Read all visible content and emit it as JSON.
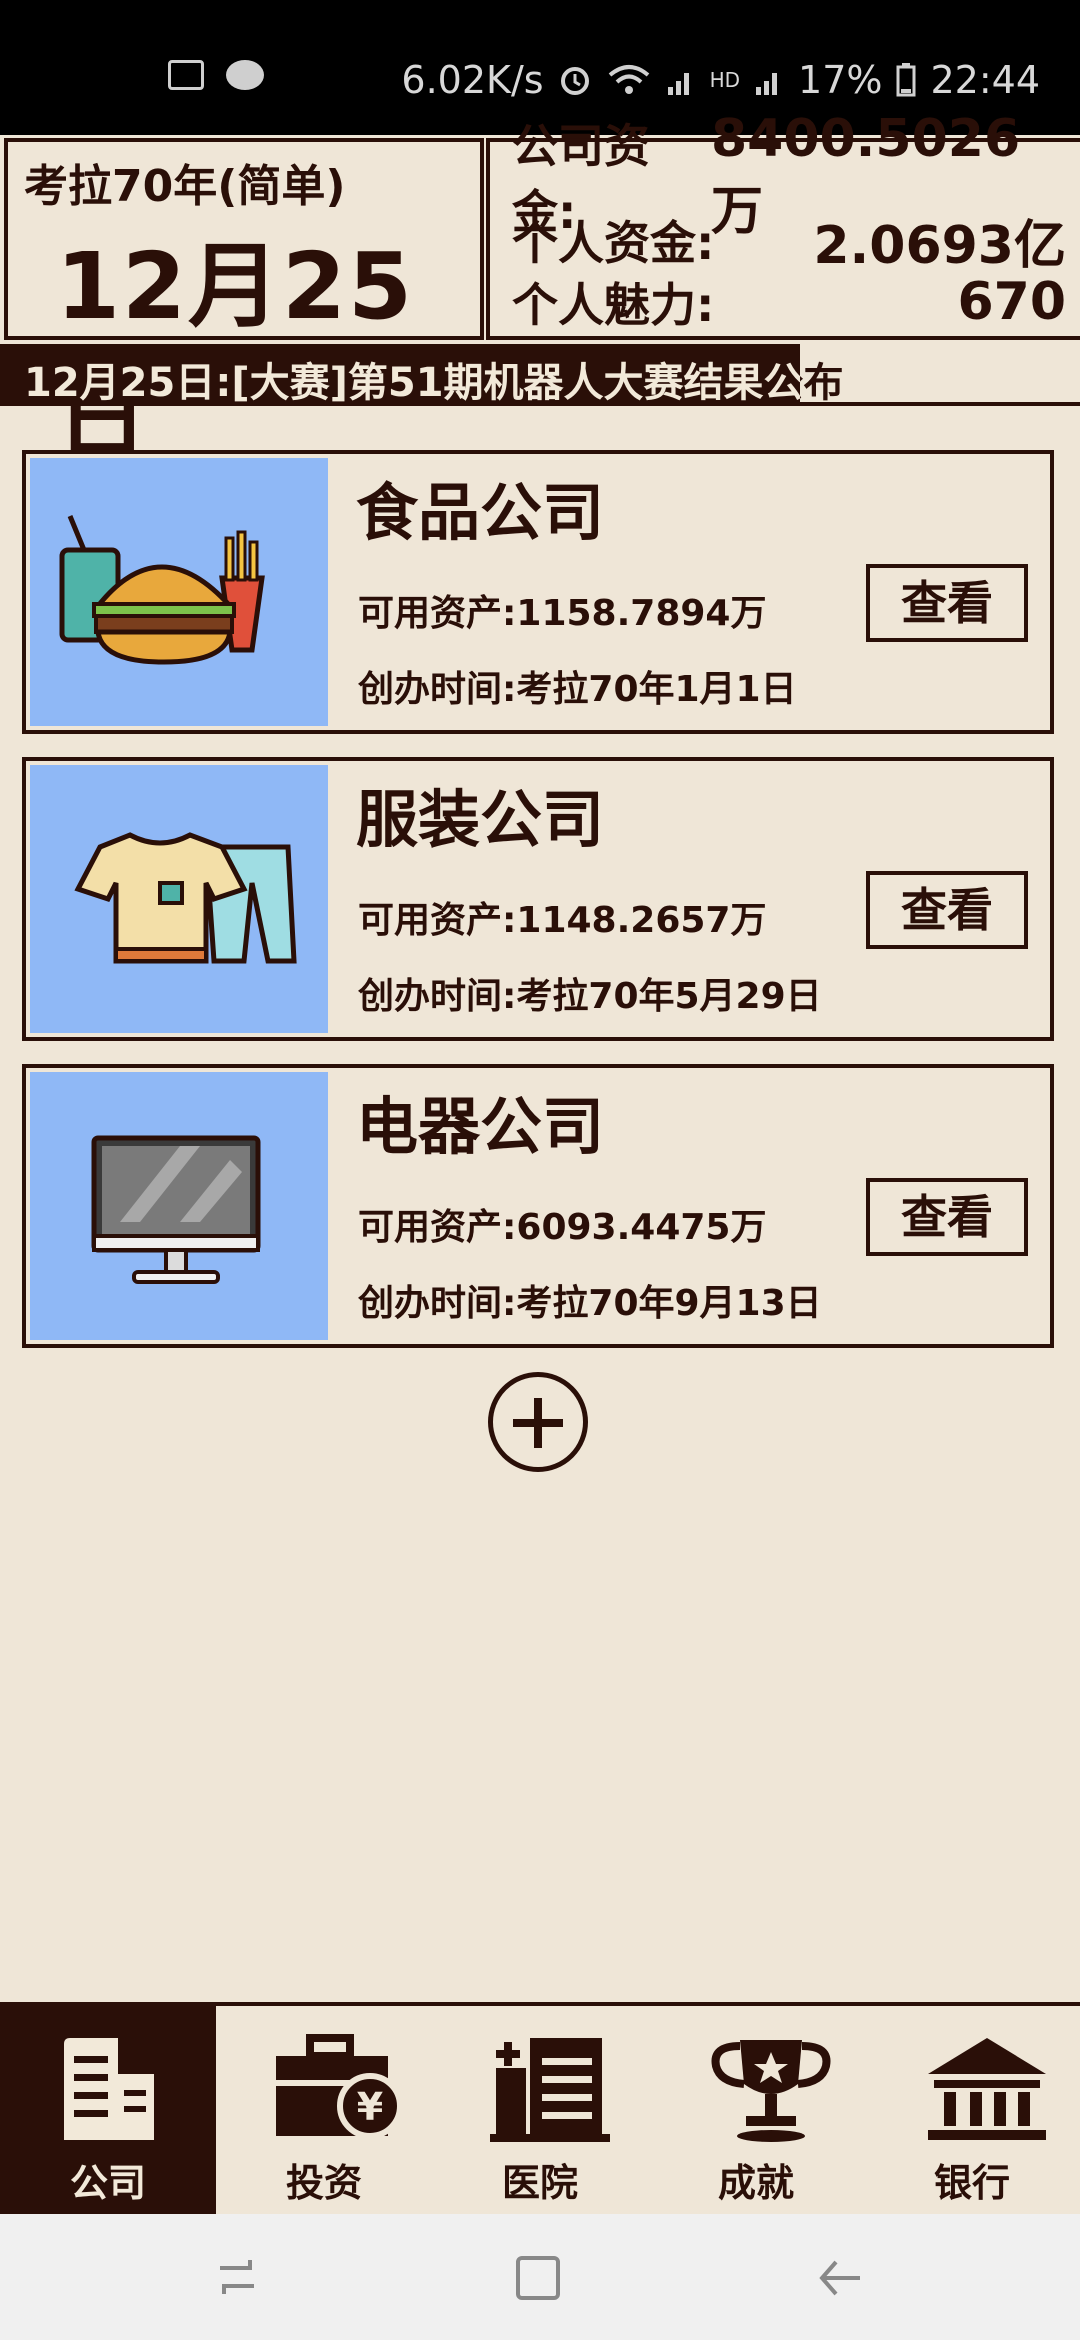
{
  "status_bar": {
    "network_speed": "6.02K/s",
    "hd": "HD",
    "battery": "17%",
    "time": "22:44"
  },
  "header": {
    "mode": "考拉70年(简单)",
    "date": "12月25日",
    "company_funds_label": "公司资金:",
    "company_funds_value": "8400.5026万",
    "personal_funds_label": "个人资金:",
    "personal_funds_value": "2.0693亿",
    "charm_label": "个人魅力:",
    "charm_value": "670"
  },
  "ticker": {
    "text": "12月25日:[大赛]第51期机器人大赛结果公布"
  },
  "companies": [
    {
      "name": "食品公司",
      "assets": "可用资产:1158.7894万",
      "founded": "创办时间:考拉70年1月1日",
      "button": "查看",
      "icon": "food-icon"
    },
    {
      "name": "服装公司",
      "assets": "可用资产:1148.2657万",
      "founded": "创办时间:考拉70年5月29日",
      "button": "查看",
      "icon": "clothing-icon"
    },
    {
      "name": "电器公司",
      "assets": "可用资产:6093.4475万",
      "founded": "创办时间:考拉70年9月13日",
      "button": "查看",
      "icon": "monitor-icon"
    }
  ],
  "nav": {
    "items": [
      {
        "label": "公司",
        "icon": "building-icon",
        "active": true
      },
      {
        "label": "投资",
        "icon": "briefcase-yen-icon",
        "active": false
      },
      {
        "label": "医院",
        "icon": "hospital-icon",
        "active": false
      },
      {
        "label": "成就",
        "icon": "trophy-icon",
        "active": false
      },
      {
        "label": "银行",
        "icon": "bank-icon",
        "active": false
      }
    ]
  },
  "colors": {
    "background": "#efe6d7",
    "dark": "#2a0f08",
    "card_image_bg": "#8fb8f6"
  }
}
